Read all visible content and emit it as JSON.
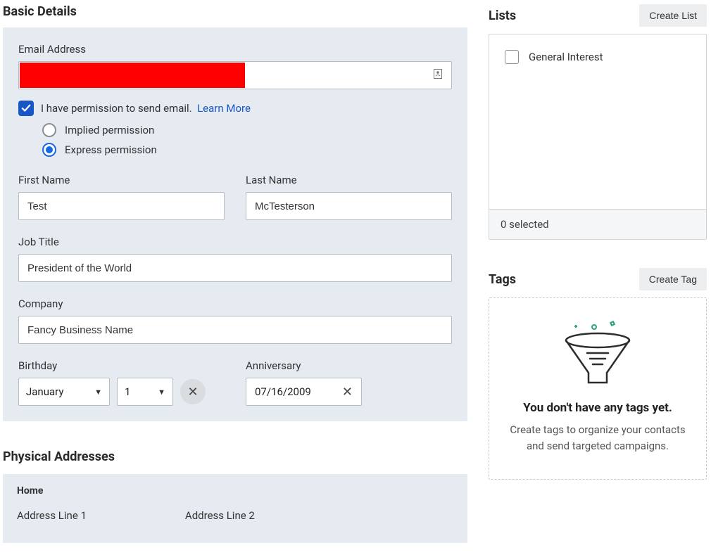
{
  "basic": {
    "title": "Basic Details",
    "emailLabel": "Email Address",
    "permissionText": "I have permission to send email.",
    "learnMore": "Learn More",
    "impliedLabel": "Implied permission",
    "expressLabel": "Express permission",
    "firstNameLabel": "First Name",
    "firstNameValue": "Test",
    "lastNameLabel": "Last Name",
    "lastNameValue": "McTesterson",
    "jobTitleLabel": "Job Title",
    "jobTitleValue": "President of the World",
    "companyLabel": "Company",
    "companyValue": "Fancy Business Name",
    "birthdayLabel": "Birthday",
    "birthdayMonth": "January",
    "birthdayDay": "1",
    "anniversaryLabel": "Anniversary",
    "anniversaryValue": "07/16/2009"
  },
  "physical": {
    "title": "Physical Addresses",
    "homeLabel": "Home",
    "addr1Label": "Address Line 1",
    "addr2Label": "Address Line 2"
  },
  "lists": {
    "title": "Lists",
    "createBtn": "Create List",
    "items": [
      {
        "label": "General Interest",
        "checked": false
      }
    ],
    "footer": "0 selected"
  },
  "tags": {
    "title": "Tags",
    "createBtn": "Create Tag",
    "emptyTitle": "You don't have any tags yet.",
    "emptyDesc": "Create tags to organize your contacts and send targeted campaigns."
  }
}
